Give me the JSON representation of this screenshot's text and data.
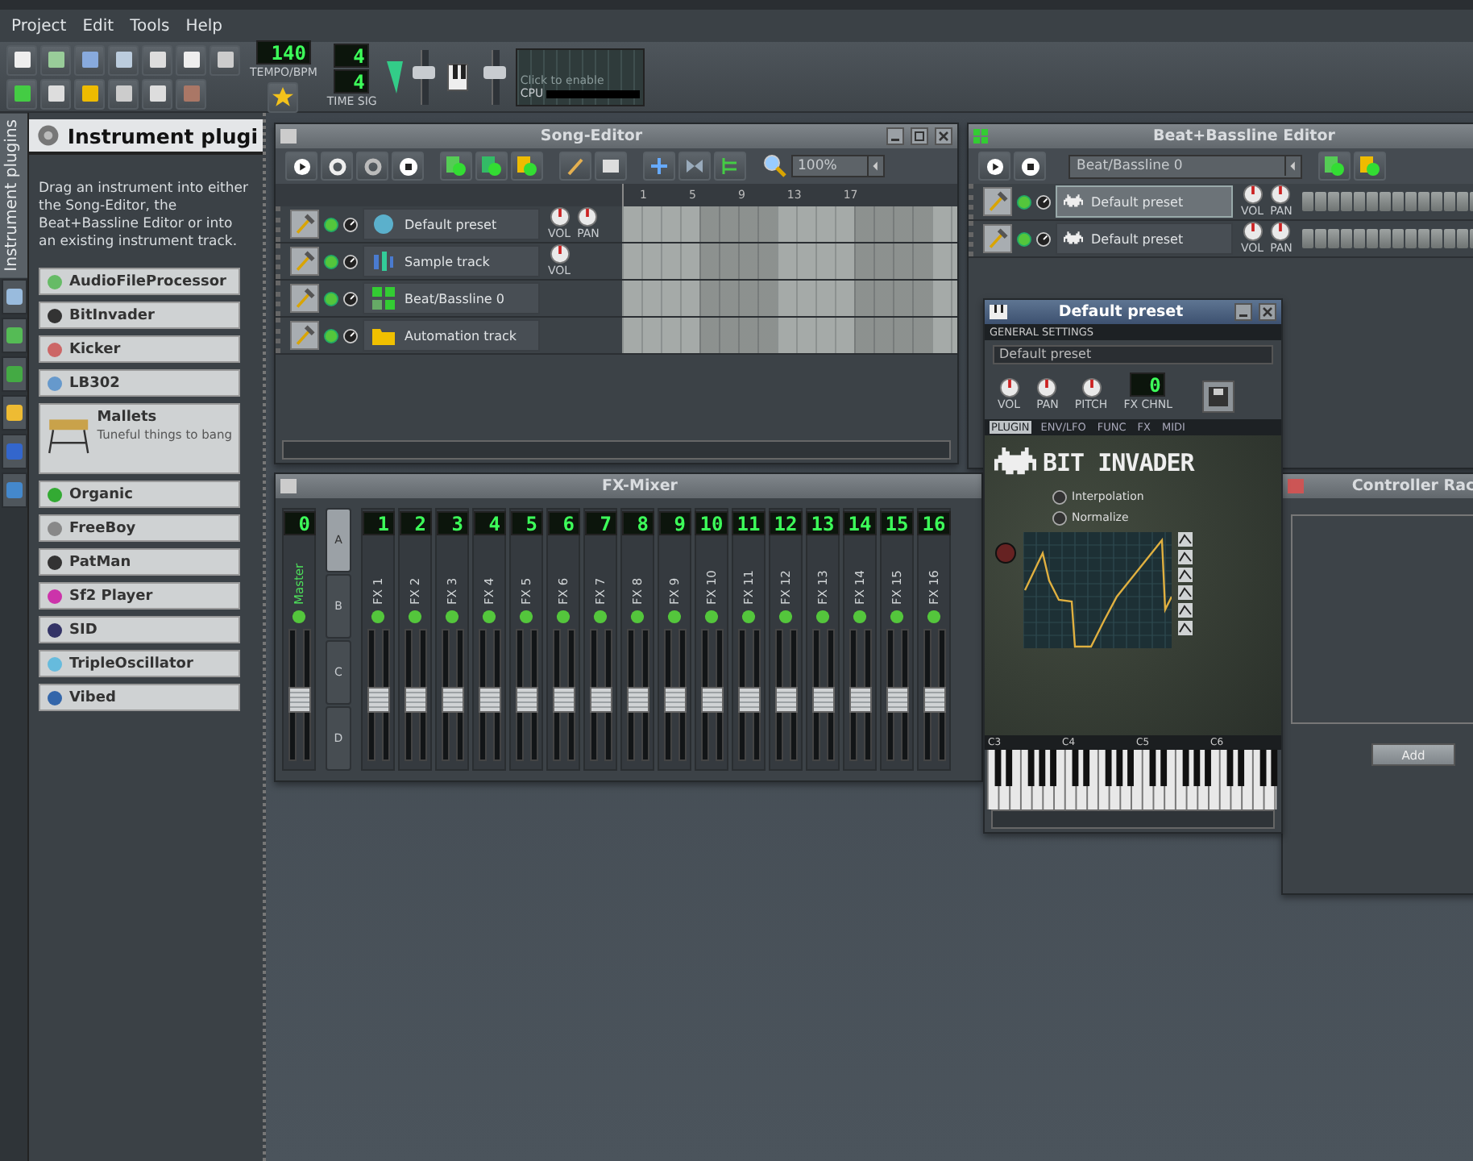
{
  "menu": [
    "Project",
    "Edit",
    "Tools",
    "Help"
  ],
  "toolbar": {
    "master_volume": {
      "level": 0.6
    },
    "master_pitch": {
      "level": 0.6
    },
    "tempo": {
      "value": "140",
      "label": "TEMPO/BPM"
    },
    "time_sig": {
      "numerator": "4",
      "denominator": "4",
      "label": "TIME SIG"
    },
    "cpu_graph": {
      "hint": "Click to enable",
      "label": "CPU"
    }
  },
  "side_tab": "Instrument plugins",
  "plugin_panel": {
    "title": "Instrument plugi",
    "description": "Drag an instrument into either the Song-Editor, the Beat+Bassline Editor or into an existing instrument track.",
    "plugins": [
      {
        "name": "AudioFileProcessor",
        "expanded": false
      },
      {
        "name": "BitInvader",
        "expanded": false
      },
      {
        "name": "Kicker",
        "expanded": false
      },
      {
        "name": "LB302",
        "expanded": false
      },
      {
        "name": "Mallets",
        "expanded": true,
        "description": "Tuneful things to bang"
      },
      {
        "name": "Organic",
        "expanded": false
      },
      {
        "name": "FreeBoy",
        "expanded": false
      },
      {
        "name": "PatMan",
        "expanded": false
      },
      {
        "name": "Sf2 Player",
        "expanded": false
      },
      {
        "name": "SID",
        "expanded": false
      },
      {
        "name": "TripleOscillator",
        "expanded": false
      },
      {
        "name": "Vibed",
        "expanded": false
      }
    ]
  },
  "song_editor": {
    "title": "Song-Editor",
    "zoom": "100%",
    "ruler": [
      "1",
      "5",
      "9",
      "13",
      "17"
    ],
    "tracks": [
      {
        "kind": "instrument",
        "name": "Default preset",
        "knobs": [
          "VOL",
          "PAN"
        ]
      },
      {
        "kind": "sample",
        "name": "Sample track",
        "knobs": [
          "VOL"
        ]
      },
      {
        "kind": "beat",
        "name": "Beat/Bassline 0"
      },
      {
        "kind": "automation",
        "name": "Automation track"
      }
    ]
  },
  "bb_editor": {
    "title": "Beat+Bassline Editor",
    "pattern": "Beat/Bassline 0",
    "tracks": [
      {
        "name": "Default preset",
        "selected": true,
        "knobs": [
          "VOL",
          "PAN"
        ]
      },
      {
        "name": "Default preset",
        "selected": false,
        "knobs": [
          "VOL",
          "PAN"
        ]
      }
    ]
  },
  "fx_mixer": {
    "title": "FX-Mixer",
    "banks": [
      {
        "label": "A",
        "selected": true
      },
      {
        "label": "B",
        "selected": false
      },
      {
        "label": "C",
        "selected": false
      },
      {
        "label": "D",
        "selected": false
      }
    ],
    "channels": [
      {
        "number": "0",
        "name": "Master",
        "level": 0.45
      },
      {
        "number": "1",
        "name": "FX 1",
        "level": 0.45
      },
      {
        "number": "2",
        "name": "FX 2",
        "level": 0.45
      },
      {
        "number": "3",
        "name": "FX 3",
        "level": 0.45
      },
      {
        "number": "4",
        "name": "FX 4",
        "level": 0.45
      },
      {
        "number": "5",
        "name": "FX 5",
        "level": 0.45
      },
      {
        "number": "6",
        "name": "FX 6",
        "level": 0.45
      },
      {
        "number": "7",
        "name": "FX 7",
        "level": 0.45
      },
      {
        "number": "8",
        "name": "FX 8",
        "level": 0.45
      },
      {
        "number": "9",
        "name": "FX 9",
        "level": 0.45
      },
      {
        "number": "10",
        "name": "FX 10",
        "level": 0.45
      },
      {
        "number": "11",
        "name": "FX 11",
        "level": 0.45
      },
      {
        "number": "12",
        "name": "FX 12",
        "level": 0.45
      },
      {
        "number": "13",
        "name": "FX 13",
        "level": 0.45
      },
      {
        "number": "14",
        "name": "FX 14",
        "level": 0.45
      },
      {
        "number": "15",
        "name": "FX 15",
        "level": 0.45
      },
      {
        "number": "16",
        "name": "FX 16",
        "level": 0.45
      }
    ]
  },
  "controller_rack": {
    "title": "Controller Rac",
    "button": "Add"
  },
  "instrument_window": {
    "title": "Default preset",
    "section": "GENERAL SETTINGS",
    "preset_name": "Default preset",
    "knobs": [
      "VOL",
      "PAN",
      "PITCH"
    ],
    "fx_channel": {
      "value": "0",
      "label": "FX CHNL"
    },
    "tabs": [
      {
        "label": "PLUGIN",
        "selected": true
      },
      {
        "label": "ENV/LFO",
        "selected": false
      },
      {
        "label": "FUNC",
        "selected": false
      },
      {
        "label": "FX",
        "selected": false
      },
      {
        "label": "MIDI",
        "selected": false
      }
    ],
    "plugin_logo": "BIT INVADER",
    "options": [
      {
        "label": "Interpolation",
        "checked": false
      },
      {
        "label": "Normalize",
        "checked": false
      }
    ],
    "keyboard_labels": [
      "C3",
      "C4",
      "C5",
      "C6"
    ]
  }
}
